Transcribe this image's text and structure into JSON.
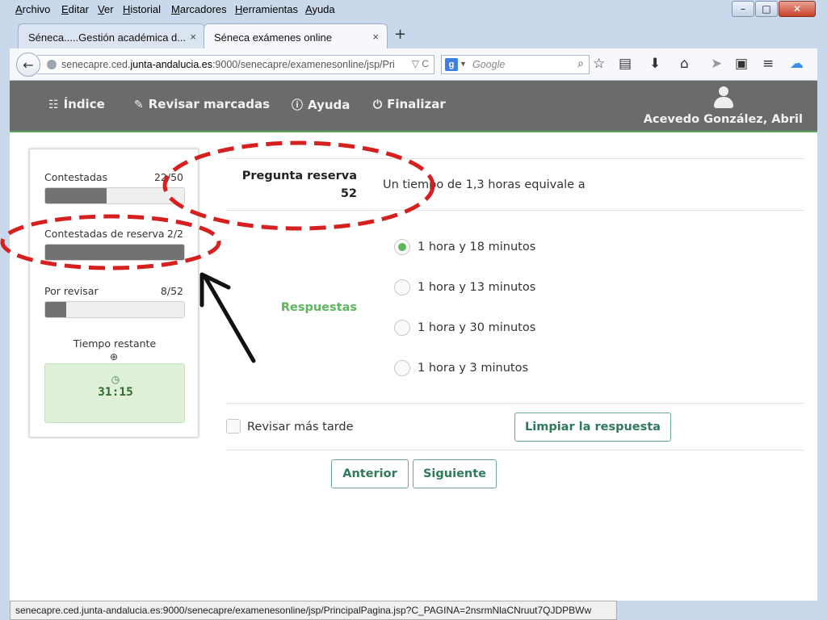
{
  "menubar": {
    "items": [
      "Archivo",
      "Editar",
      "Ver",
      "Historial",
      "Marcadores",
      "Herramientas",
      "Ayuda"
    ],
    "window_buttons": [
      "–",
      "□",
      "✕"
    ]
  },
  "tabs": [
    {
      "label": "Séneca.....Gestión académica d...",
      "close": "×",
      "active": false
    },
    {
      "label": "Séneca exámenes online",
      "close": "×",
      "active": true
    }
  ],
  "new_tab": "+",
  "navbar": {
    "url_prefix": "senecapre.ced.",
    "url_domain": "junta-andalucia.es",
    "url_rest": ":9000/senecapre/examenesonline/jsp/Pri",
    "url_tools": "▽ C",
    "search_engine": "g",
    "search_placeholder": "Google"
  },
  "header": {
    "nav": [
      {
        "label": "Índice",
        "icon": "sitemap-icon"
      },
      {
        "label": "Revisar marcadas",
        "icon": "pencil-icon"
      },
      {
        "label": "Ayuda",
        "icon": "info-icon"
      },
      {
        "label": "Finalizar",
        "icon": "power-icon"
      }
    ],
    "user_name": "Acevedo González, Abril"
  },
  "progress": {
    "answered": {
      "label": "Contestadas",
      "count": "22/50",
      "fraction": 0.44
    },
    "reserve": {
      "label": "Contestadas de reserva",
      "count": "2/2",
      "fraction": 1.0
    },
    "review": {
      "label": "Por revisar",
      "count": "8/52",
      "fraction": 0.154
    }
  },
  "timer": {
    "label": "Tiempo restante",
    "value": "31:15"
  },
  "question": {
    "title": "Pregunta reserva",
    "number": "52",
    "text": "Un tiempo de 1,3 horas equivale a"
  },
  "answers": {
    "label": "Respuestas",
    "options": [
      "1 hora y 18 minutos",
      "1 hora y 13 minutos",
      "1 hora y 30 minutos",
      "1 hora y 3 minutos"
    ],
    "selected_index": 0
  },
  "review_later": "Revisar más tarde",
  "buttons": {
    "clear": "Limpiar la respuesta",
    "previous": "Anterior",
    "next": "Siguiente"
  },
  "status_url": "senecapre.ced.junta-andalucia.es:9000/senecapre/examenesonline/jsp/PrincipalPagina.jsp?C_PAGINA=2nsrmNlaCNruut7QJDPBWw",
  "colors": {
    "header_bg": "#6b6b6b",
    "accent_green": "#5cb85c",
    "annotation_red": "#d62020"
  }
}
